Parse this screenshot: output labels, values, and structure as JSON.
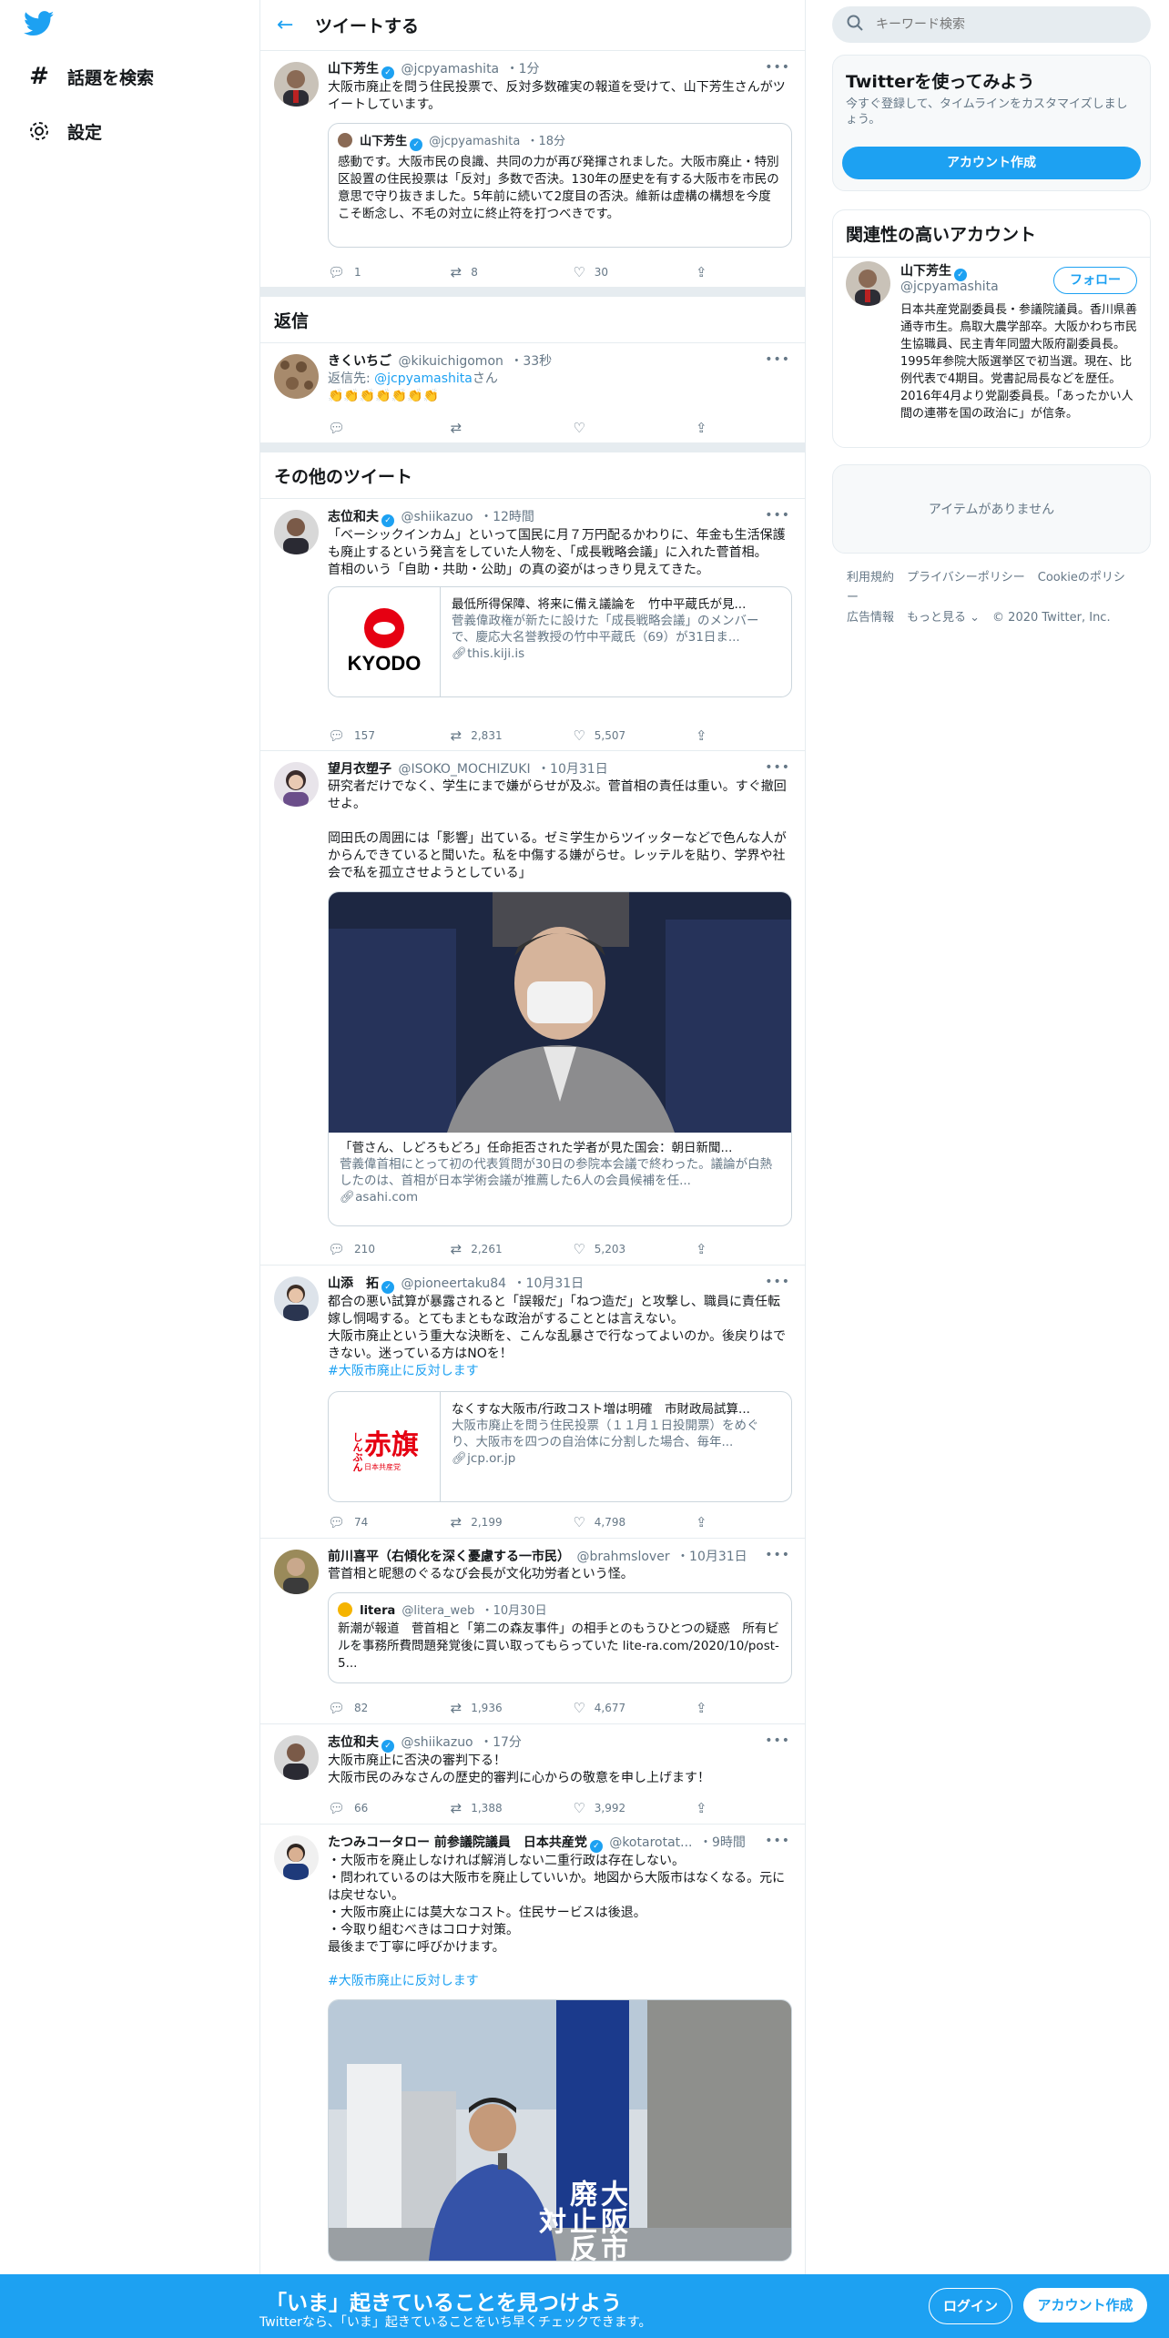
{
  "nav": {
    "explore": "話題を検索",
    "settings": "設定"
  },
  "header": {
    "title": "ツイートする"
  },
  "main_tweet": {
    "name": "山下芳生",
    "handle": "@jcpyamashita",
    "time": "・1分",
    "text": "大阪市廃止を問う住民投票で、反対多数確実の報道を受けて、山下芳生さんがツイートしています。",
    "quote": {
      "name": "山下芳生",
      "handle": "@jcpyamashita",
      "time": "・18分",
      "text": "感動です。大阪市民の良識、共同の力が再び発揮されました。大阪市廃止・特別区設置の住民投票は「反対」多数で否決。130年の歴史を有する大阪市を市民の意思で守り抜きました。5年前に続いて2度目の否決。維新は虚構の構想を今度こそ断念し、不毛の対立に終止符を打つべきです。"
    },
    "replies": "1",
    "retweets": "8",
    "likes": "30"
  },
  "replies_section": {
    "title": "返信",
    "reply": {
      "name": "きくいちご",
      "handle": "@kikuichigomon",
      "time": "・33秒",
      "reply_to_prefix": "返信先: ",
      "reply_to_handle": "@jcpyamashita",
      "reply_to_suffix": "さん",
      "text": "👏👏👏👏👏👏👏"
    }
  },
  "others_section": {
    "title": "その他のツイート"
  },
  "tweets": [
    {
      "name": "志位和夫",
      "handle": "@shiikazuo",
      "time": "・12時間",
      "text": "「ベーシックインカム」といって国民に月７万円配るかわりに、年金も生活保護も廃止するという発言をしていた人物を、「成長戦略会議」に入れた菅首相。\n首相のいう「自助・共助・公助」の真の姿がはっきり見えてきた。",
      "card": {
        "logo": "KYODO",
        "title": "最低所得保障、将来に備え議論を　竹中平蔵氏が見...",
        "desc": "菅義偉政権が新たに設けた「成長戦略会議」のメンバーで、慶応大名誉教授の竹中平蔵氏（69）が31日ま...",
        "link": "this.kiji.is"
      },
      "replies": "157",
      "retweets": "2,831",
      "likes": "5,507"
    },
    {
      "name": "望月衣塑子",
      "handle": "@ISOKO_MOCHIZUKI",
      "time": "・10月31日",
      "text": "研究者だけでなく、学生にまで嫌がらせが及ぶ。菅首相の責任は重い。すぐ撤回せよ。\n\n岡田氏の周囲には「影響」出ている。ゼミ学生からツイッターなどで色んな人がからんできていると聞いた。私を中傷する嫌がらせ。レッテルを貼り、学界や社会で私を孤立させようとしている」",
      "card": {
        "title": "「菅さん、しどろもどろ」任命拒否された学者が見た国会：朝日新聞...",
        "desc": "菅義偉首相にとって初の代表質問が30日の参院本会議で終わった。議論が白熱したのは、首相が日本学術会議が推薦した6人の会員候補を任...",
        "link": "asahi.com"
      },
      "replies": "210",
      "retweets": "2,261",
      "likes": "5,203"
    },
    {
      "name": "山添　拓",
      "handle": "@pioneertaku84",
      "time": "・10月31日",
      "text": "都合の悪い試算が暴露されると「誤報だ」「ねつ造だ」と攻撃し、職員に責任転嫁し恫喝する。とてもまともな政治がすることとは言えない。\n大阪市廃止という重大な決断を、こんな乱暴さで行なってよいのか。後戻りはできない。迷っている方はNOを！",
      "hashtag": "#大阪市廃止に反対します",
      "card": {
        "logo_small": "しんぶん",
        "logo_big": "赤旗",
        "logo_sub": "日本共産党",
        "title": "なくすな大阪市/行政コスト増は明確　市財政局試算...",
        "desc": "大阪市廃止を問う住民投票（１１月１日投開票）をめぐり、大阪市を四つの自治体に分割した場合、毎年...",
        "link": "jcp.or.jp"
      },
      "replies": "74",
      "retweets": "2,199",
      "likes": "4,798"
    },
    {
      "name": "前川喜平（右傾化を深く憂慮する一市民）",
      "handle": "@brahmslover",
      "time": "・10月31日",
      "text": "菅首相と昵懇のぐるなび会長が文化功労者という怪。",
      "quote": {
        "name": "litera",
        "handle": "@litera_web",
        "time": "・10月30日",
        "text": "新潮が報道　菅首相と「第二の森友事件」の相手とのもうひとつの疑惑　所有ビルを事務所費問題発覚後に買い取ってもらっていた lite-ra.com/2020/10/post-5..."
      },
      "replies": "82",
      "retweets": "1,936",
      "likes": "4,677"
    },
    {
      "name": "志位和夫",
      "handle": "@shiikazuo",
      "time": "・17分",
      "text": "大阪市廃止に否決の審判下る！\n大阪市民のみなさんの歴史的審判に心からの敬意を申し上げます！",
      "replies": "66",
      "retweets": "1,388",
      "likes": "3,992"
    },
    {
      "name": "たつみコータロー 前参議院議員　日本共産党",
      "handle": "@kotarotat...",
      "time": "・9時間",
      "text": "・大阪市を廃止しなければ解消しない二重行政は存在しない。\n・問われているのは大阪市を廃止していいか。地図から大阪市はなくなる。元には戻せない。\n・大阪市廃止には莫大なコスト。住民サービスは後退。\n・今取り組むべきはコロナ対策。\n最後まで丁寧に呼びかけます。",
      "hashtag": "#大阪市廃止に反対します",
      "banner_text": "大阪市廃止反対"
    }
  ],
  "sidebar": {
    "search_placeholder": "キーワード検索",
    "join": {
      "title": "Twitterを使ってみよう",
      "subtitle": "今すぐ登録して、タイムラインをカスタマイズしましょう。",
      "button": "アカウント作成"
    },
    "related": {
      "title": "関連性の高いアカウント",
      "name": "山下芳生",
      "handle": "@jcpyamashita",
      "follow": "フォロー",
      "bio": "日本共産党副委員長・参議院議員。香川県善通寺市生。鳥取大農学部卒。大阪かわち市民生協職員、民主青年同盟大阪府副委員長。1995年参院大阪選挙区で初当選。現在、比例代表で4期目。党書記局長などを歴任。2016年4月より党副委員長。「あったかい人間の連帯を国の政治に」が信条。"
    },
    "trends_empty": "アイテムがありません",
    "footer": [
      "利用規約",
      "プライバシーポリシー",
      "Cookieのポリシー",
      "広告情報",
      "もっと見る ⌄",
      "© 2020 Twitter, Inc."
    ]
  },
  "bottom_bar": {
    "title": "「いま」起きていることを見つけよう",
    "subtitle": "Twitterなら、「いま」起きていることをいち早くチェックできます。",
    "login": "ログイン",
    "signup": "アカウント作成"
  },
  "colors": {
    "accent": "#1da1f2",
    "border": "#e6ecf0",
    "muted": "#657786"
  }
}
